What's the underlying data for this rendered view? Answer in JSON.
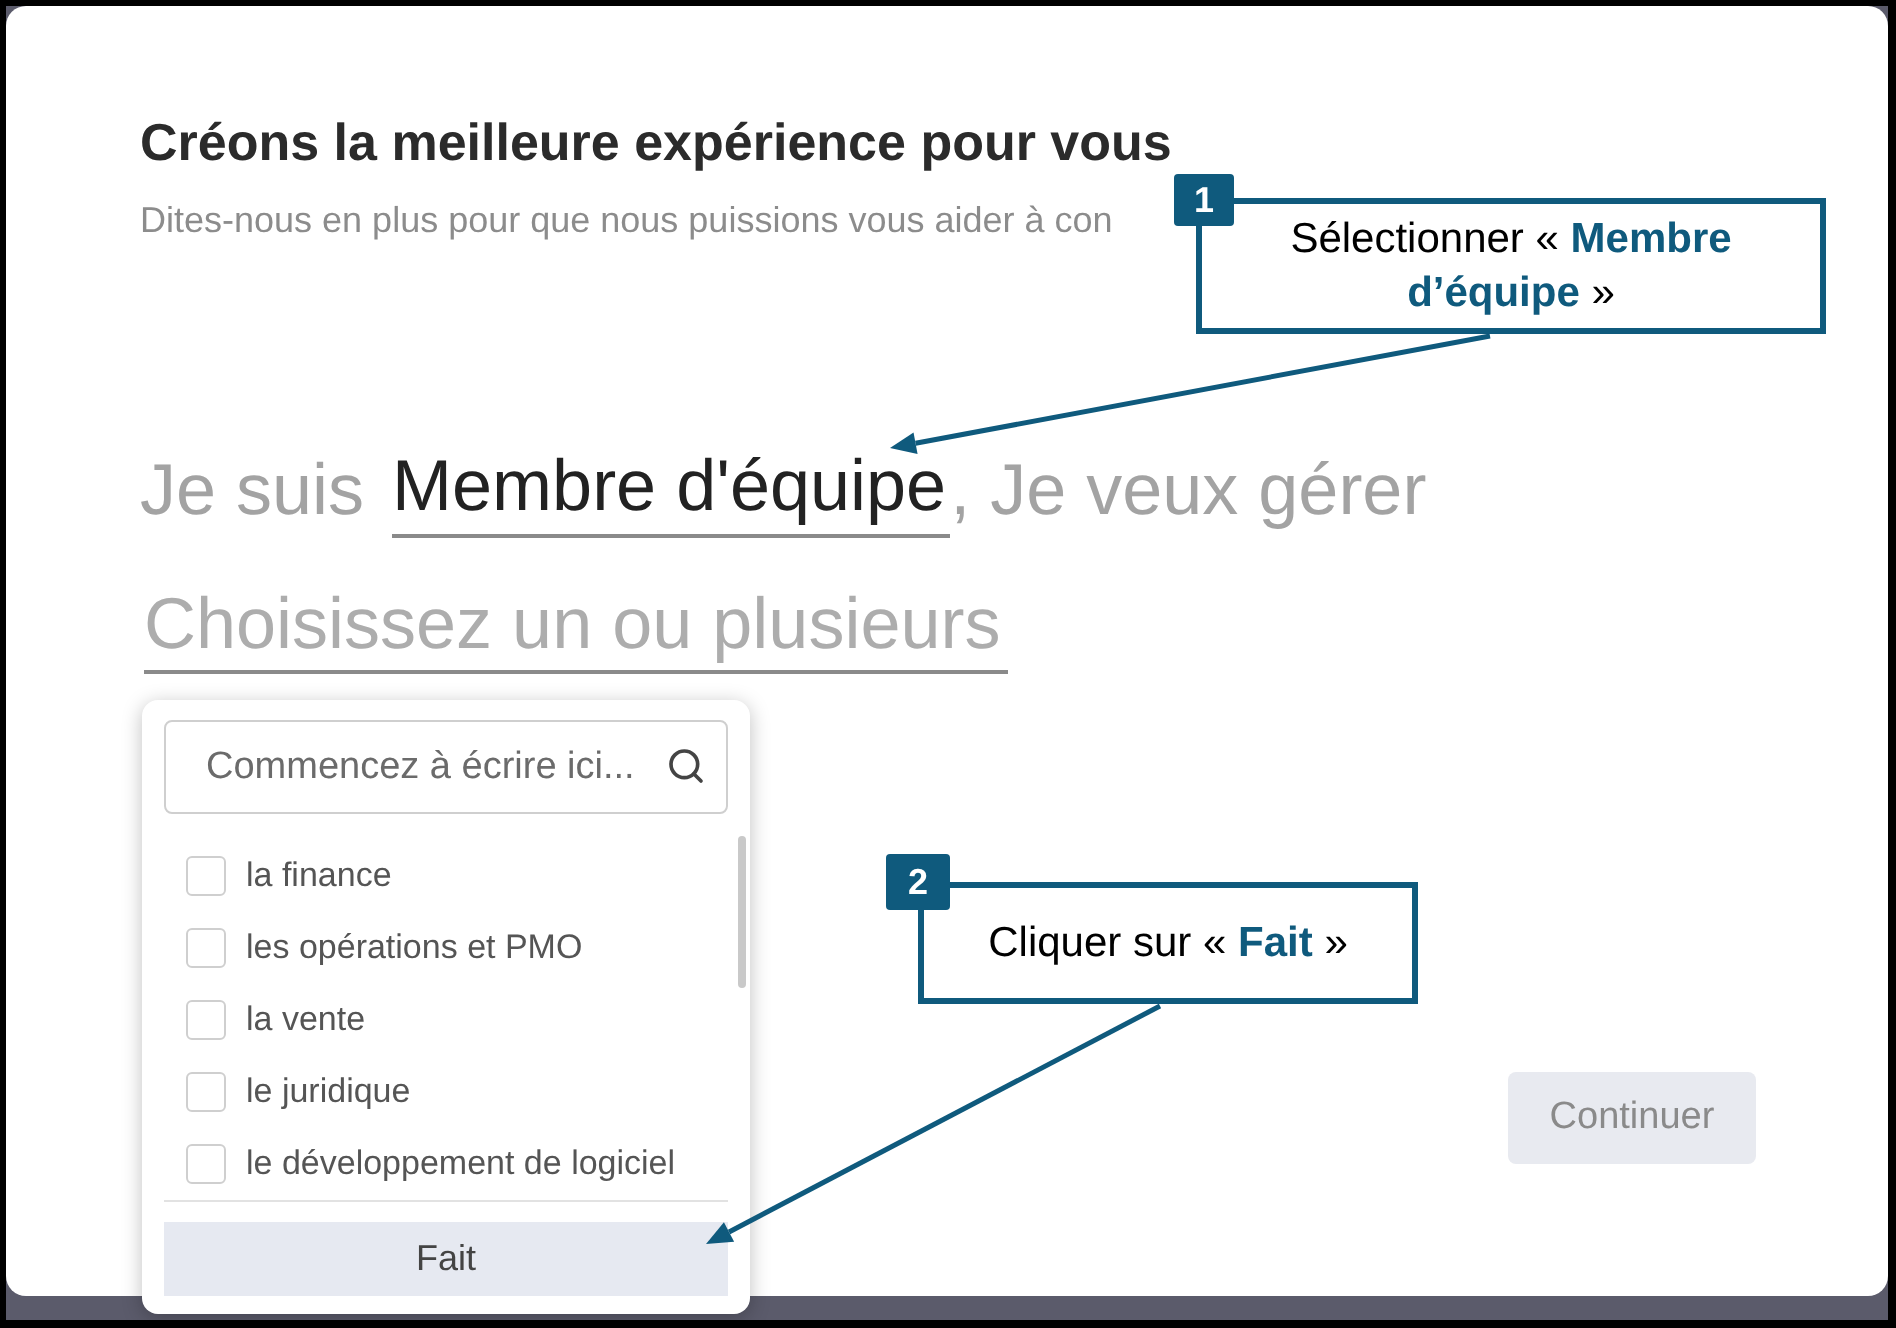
{
  "dialog": {
    "title": "Créons la meilleure expérience pour vous",
    "subtitle": "Dites-nous en plus pour que nous puissions vous aider à con"
  },
  "sentence": {
    "prefix": "Je suis",
    "role_field": {
      "value": "Membre d'équipe"
    },
    "suffix": ", Je veux gérer",
    "areas_field": {
      "placeholder": "Choisissez un ou plusieurs"
    }
  },
  "dropdown": {
    "search": {
      "placeholder": "Commencez à écrire ici..."
    },
    "options": [
      {
        "label": "la finance",
        "checked": false
      },
      {
        "label": "les opérations et PMO",
        "checked": false
      },
      {
        "label": "la vente",
        "checked": false
      },
      {
        "label": "le juridique",
        "checked": false
      },
      {
        "label": "le développement de logiciel",
        "checked": false
      }
    ],
    "done_button": "Fait"
  },
  "continue_button": {
    "label": "Continuer",
    "disabled": true
  },
  "callouts": [
    {
      "step": "1",
      "text": "Sélectionner « **Membre d’équipe** »"
    },
    {
      "step": "2",
      "text": "Cliquer sur « **Fait** »"
    }
  ]
}
